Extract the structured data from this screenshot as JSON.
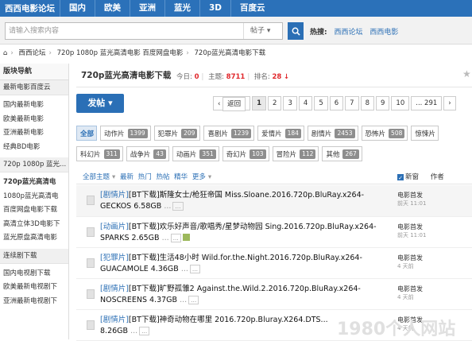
{
  "topnav": {
    "logo": "西西电影论坛",
    "items": [
      "国内",
      "欧美",
      "亚洲",
      "蓝光",
      "3D",
      "百度云"
    ]
  },
  "search": {
    "placeholder": "请输入搜索内容",
    "type": "帖子",
    "hot_label": "热搜:",
    "hot": [
      "西西论坛",
      "西西电影"
    ]
  },
  "breadcrumb": [
    "西西论坛",
    "720p 1080p 蓝光高清电影 百度网盘电影",
    "720p蓝光高清电影下载"
  ],
  "sidebar": {
    "header": "版块导航",
    "groups": [
      {
        "label": "最新电影百度云",
        "items": [
          "国内最新电影",
          "欧美最新电影",
          "亚洲最新电影",
          "经典BD电影"
        ]
      },
      {
        "label": "720p 1080p 蓝光...",
        "items": [
          "720p蓝光高清电",
          "1080p蓝光高清电",
          "百度网盘电影下载",
          "高清立体3D电影下",
          "蓝光原盘高清电影"
        ]
      },
      {
        "label": "连续剧下载",
        "items": [
          "国内电视剧下载",
          "欧美最新电视剧下",
          "亚洲最新电视剧下"
        ]
      }
    ]
  },
  "forum": {
    "title": "720p蓝光高清电影下载",
    "today_label": "今日:",
    "today": "0",
    "topics_label": "主题:",
    "topics": "8711",
    "rank_label": "排名:",
    "rank": "28"
  },
  "post_button": "发帖",
  "pager": {
    "prev": "返回",
    "pages": [
      "1",
      "2",
      "3",
      "4",
      "5",
      "6",
      "7",
      "8",
      "9",
      "10",
      "... 291"
    ]
  },
  "categories": {
    "row1": [
      {
        "name": "全部",
        "count": ""
      },
      {
        "name": "动作片",
        "count": "1399"
      },
      {
        "name": "犯罪片",
        "count": "209"
      },
      {
        "name": "喜剧片",
        "count": "1239"
      },
      {
        "name": "爱情片",
        "count": "184"
      },
      {
        "name": "剧情片",
        "count": "2453"
      },
      {
        "name": "恐怖片",
        "count": "508"
      },
      {
        "name": "惊悚片",
        "count": ""
      }
    ],
    "row2": [
      {
        "name": "科幻片",
        "count": "311"
      },
      {
        "name": "战争片",
        "count": "43"
      },
      {
        "name": "动画片",
        "count": "351"
      },
      {
        "name": "奇幻片",
        "count": "103"
      },
      {
        "name": "冒险片",
        "count": "112"
      },
      {
        "name": "其他",
        "count": "267"
      }
    ]
  },
  "filter": {
    "all": "全部主题",
    "items": [
      "最新",
      "热门",
      "热帖",
      "精华",
      "更多"
    ],
    "newwin": "新窗",
    "author": "作者"
  },
  "threads": [
    {
      "tag": "[剧情片]",
      "title": "[BT下载]斯隆女士/枪狂帝国 Miss.Sloane.2016.720p.BluRay.x264-GECKOS 6.58GB",
      "page": "...",
      "author": "电影首发",
      "date": "前天 11:01"
    },
    {
      "tag": "[动画片]",
      "title": "[BT下载]欢乐好声音/歌唱秀/星梦动物园 Sing.2016.720p.BluRay.x264-SPARKS 2.65GB",
      "page": "...",
      "author": "电影首发",
      "date": "前天 11:01"
    },
    {
      "tag": "[犯罪片]",
      "title": "[BT下载]生活48小时 Wild.for.the.Night.2016.720p.BluRay.x264-GUACAMOLE 4.36GB",
      "page": "...",
      "author": "电影首发",
      "date": "4 天前"
    },
    {
      "tag": "[剧情片]",
      "title": "[BT下载]旷野孤雏2 Against.the.Wild.2.2016.720p.BluRay.x264-NOSCREENS 4.37GB",
      "page": "...",
      "author": "电影首发",
      "date": "4 天前"
    },
    {
      "tag": "[剧情片]",
      "title": "[BT下载]神奇动物在哪里 2016.720p.Bluray.X264.DTS...",
      "page": "...",
      "author": "电影首发",
      "date": "4 天前",
      "extra": "8.26GB"
    }
  ],
  "watermark": "1980个人网站",
  "colors": {
    "nav": "#2b71b9",
    "accent": "#e0282c",
    "button": "#2a6fb6"
  }
}
